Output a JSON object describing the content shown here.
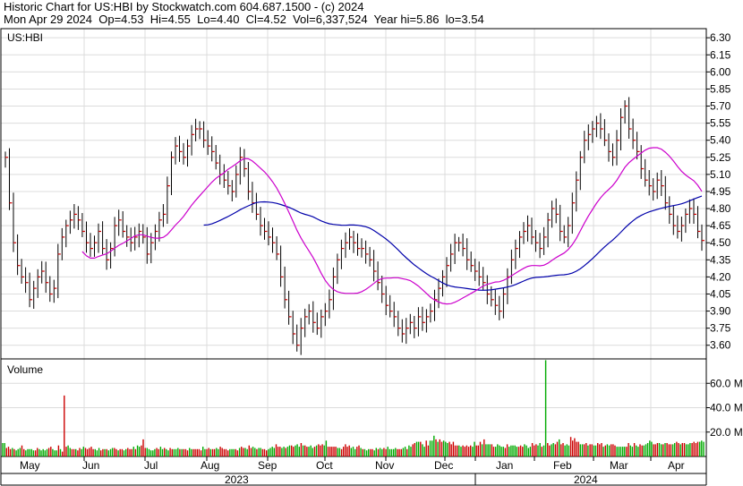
{
  "header": {
    "line1": "Historic Chart for US:HBI by Stockwatch.com 604.687.1500 - (c) 2024",
    "line2": "Mon Apr 29 2024  Op=4.53  Hi=4.55  Lo=4.40  Cl=4.52  Vol=6,337,524  Year hi=5.86  lo=3.54"
  },
  "chart_data": {
    "type": "ohlc-bar",
    "symbol_label": "US:HBI",
    "price_axis": {
      "ticks": [
        "6.30",
        "6.15",
        "6.00",
        "5.85",
        "5.70",
        "5.55",
        "5.40",
        "5.25",
        "5.10",
        "4.95",
        "4.80",
        "4.65",
        "4.50",
        "4.35",
        "4.20",
        "4.05",
        "3.90",
        "3.75",
        "3.60"
      ],
      "range": [
        3.48,
        6.38
      ]
    },
    "volume_panel": {
      "label": "Volume",
      "ticks": [
        "60.0 M",
        "40.0 M",
        "20.0 M"
      ],
      "range_millions": [
        0,
        80
      ]
    },
    "x_axis": {
      "months": [
        "May",
        "Jun",
        "Jul",
        "Aug",
        "Sep",
        "Oct",
        "Nov",
        "Dec",
        "Jan",
        "Feb",
        "Mar",
        "Apr"
      ],
      "years": [
        "2023",
        "2024"
      ]
    },
    "series": [
      {
        "name": "price",
        "color": "#000000",
        "close_tick_color": "#cc0000"
      },
      {
        "name": "short moving average",
        "color": "#cc00cc"
      },
      {
        "name": "long moving average",
        "color": "#0000aa"
      },
      {
        "name": "volume",
        "up_color": "#00aa00",
        "down_color": "#cc0000"
      }
    ],
    "closes": [
      5.25,
      4.85,
      4.5,
      4.3,
      4.2,
      4.15,
      4.0,
      4.1,
      4.2,
      4.25,
      4.15,
      4.05,
      4.1,
      4.4,
      4.55,
      4.65,
      4.7,
      4.75,
      4.7,
      4.6,
      4.5,
      4.45,
      4.5,
      4.6,
      4.45,
      4.35,
      4.45,
      4.65,
      4.7,
      4.6,
      4.55,
      4.5,
      4.55,
      4.6,
      4.55,
      4.4,
      4.5,
      4.6,
      4.7,
      4.75,
      5.0,
      5.25,
      5.35,
      5.3,
      5.25,
      5.35,
      5.45,
      5.5,
      5.5,
      5.4,
      5.35,
      5.3,
      5.2,
      5.1,
      5.05,
      5.0,
      4.95,
      5.1,
      5.25,
      5.15,
      4.95,
      4.85,
      4.75,
      4.65,
      4.6,
      4.55,
      4.5,
      4.4,
      4.2,
      4.0,
      3.85,
      3.7,
      3.6,
      3.75,
      3.85,
      3.9,
      3.8,
      3.75,
      3.85,
      3.9,
      4.0,
      4.2,
      4.35,
      4.45,
      4.5,
      4.55,
      4.5,
      4.45,
      4.45,
      4.4,
      4.35,
      4.25,
      4.15,
      4.05,
      3.95,
      3.9,
      3.85,
      3.75,
      3.7,
      3.75,
      3.8,
      3.75,
      3.85,
      3.8,
      3.85,
      3.9,
      4.0,
      4.1,
      4.2,
      4.3,
      4.4,
      4.5,
      4.5,
      4.45,
      4.35,
      4.3,
      4.25,
      4.2,
      4.15,
      4.05,
      4.0,
      3.95,
      3.9,
      4.05,
      4.2,
      4.35,
      4.45,
      4.55,
      4.6,
      4.65,
      4.55,
      4.5,
      4.45,
      4.55,
      4.7,
      4.8,
      4.75,
      4.6,
      4.55,
      4.65,
      4.85,
      5.05,
      5.25,
      5.4,
      5.45,
      5.5,
      5.55,
      5.5,
      5.4,
      5.3,
      5.25,
      5.4,
      5.6,
      5.7,
      5.5,
      5.4,
      5.3,
      5.15,
      5.05,
      5.0,
      4.95,
      5.05,
      5.0,
      4.85,
      4.75,
      4.65,
      4.6,
      4.65,
      4.75,
      4.8,
      4.75,
      4.6,
      4.52
    ],
    "volumes_m": [
      11,
      11,
      7,
      8,
      6,
      7,
      6,
      5,
      6,
      7,
      9,
      6,
      5,
      6,
      6,
      6,
      5,
      5,
      7,
      6,
      5,
      6,
      5,
      6,
      7,
      8,
      6,
      5,
      5,
      9,
      6,
      4,
      50,
      8,
      9,
      7,
      6,
      6,
      6,
      5,
      7,
      6,
      8,
      7,
      6,
      7,
      8,
      6,
      6,
      5,
      7,
      5,
      6,
      6,
      6,
      5,
      6,
      7,
      7,
      6,
      5,
      6,
      6,
      5,
      6,
      7,
      6,
      6,
      8,
      6,
      9,
      8,
      9,
      14,
      7,
      7,
      6,
      5,
      5,
      6,
      7,
      6,
      8,
      6,
      7,
      6,
      5,
      7,
      6,
      6,
      6,
      7,
      6,
      6,
      6,
      6,
      5,
      7,
      6,
      6,
      6,
      6,
      6,
      5,
      8,
      6,
      6,
      7,
      6,
      6,
      6,
      7,
      6,
      8,
      7,
      6,
      6,
      5,
      6,
      6,
      6,
      6,
      5,
      7,
      8,
      7,
      7,
      6,
      9,
      7,
      8,
      7,
      6,
      7,
      7,
      6,
      6,
      5,
      6,
      7,
      8,
      7,
      10,
      8,
      8,
      7,
      8,
      7,
      8,
      9,
      9,
      8,
      9,
      10,
      8,
      11,
      9,
      9,
      8,
      8,
      9,
      7,
      8,
      9,
      10,
      9,
      10,
      9,
      13,
      8,
      8,
      8,
      8,
      8,
      7,
      7,
      6,
      8,
      10,
      8,
      9,
      7,
      8,
      6,
      8,
      9,
      7,
      6,
      6,
      5,
      6,
      6,
      6,
      5,
      7,
      6,
      7,
      6,
      7,
      6,
      8,
      6,
      6,
      6,
      7,
      6,
      6,
      6,
      7,
      8,
      6,
      9,
      8,
      10,
      11,
      12,
      12,
      12,
      10,
      8,
      13,
      9,
      13,
      13,
      17,
      14,
      12,
      14,
      12,
      13,
      12,
      11,
      12,
      10,
      12,
      9,
      9,
      9,
      8,
      9,
      8,
      9,
      8,
      9,
      8,
      12,
      9,
      9,
      12,
      10,
      14,
      10,
      10,
      10,
      10,
      8,
      8,
      10,
      9,
      8,
      8,
      7,
      10,
      8,
      9,
      9,
      9,
      8,
      8,
      9,
      8,
      10,
      9,
      7,
      8,
      11,
      9,
      10,
      9,
      11,
      8,
      9,
      79,
      11,
      9,
      10,
      11,
      10,
      12,
      14,
      10,
      11,
      9,
      10,
      9,
      16,
      13,
      15,
      12,
      12,
      10,
      10,
      10,
      11,
      9,
      10,
      10,
      9,
      9,
      11,
      10,
      11,
      8,
      9,
      10,
      9,
      10,
      10,
      9,
      8,
      8,
      8,
      8,
      8,
      8,
      11,
      9,
      8,
      11,
      9,
      8,
      10,
      9,
      9,
      10,
      11,
      13,
      12,
      10,
      10,
      11,
      11,
      10,
      10,
      11,
      11,
      10,
      10,
      10,
      11,
      12,
      11,
      10,
      11,
      11,
      10,
      10,
      11,
      11,
      12,
      11,
      12,
      12,
      13,
      12
    ]
  }
}
